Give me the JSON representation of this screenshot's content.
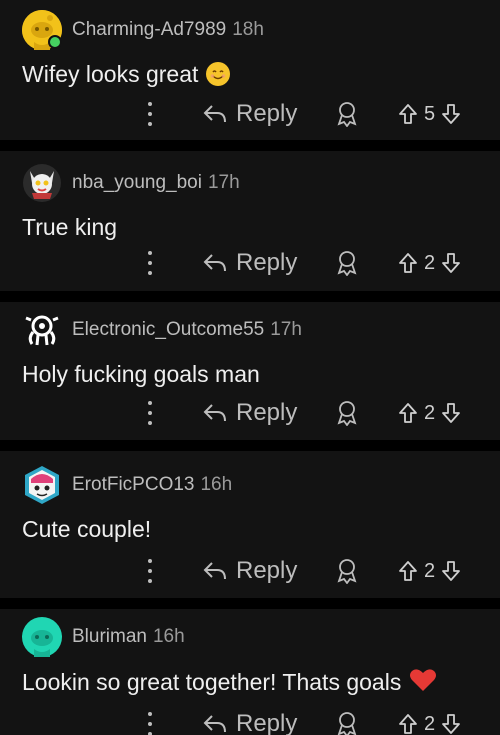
{
  "colors": {
    "background": "#000000",
    "card": "#131313",
    "online": "#46d160"
  },
  "comments": [
    {
      "username": "Charming-Ad7989",
      "time": "18h",
      "text": "Wifey looks great",
      "emoji": "smiling-face",
      "reply_label": "Reply",
      "votes": "5",
      "avatar": "reddit-snoo-yellow"
    },
    {
      "username": "nba_young_boi",
      "time": "17h",
      "text": "True king",
      "reply_label": "Reply",
      "votes": "2",
      "avatar": "fox-character"
    },
    {
      "username": "Electronic_Outcome55",
      "time": "17h",
      "text": "Holy fucking goals man",
      "reply_label": "Reply",
      "votes": "2",
      "avatar": "octopus-logo"
    },
    {
      "username": "ErotFicPCO13",
      "time": "16h",
      "text": "Cute couple!",
      "reply_label": "Reply",
      "votes": "2",
      "avatar": "hexagon-character"
    },
    {
      "username": "Bluriman",
      "time": "16h",
      "text": "Lookin so great together! Thats goals",
      "emoji": "red-heart",
      "reply_label": "Reply",
      "votes": "2",
      "avatar": "reddit-snoo-teal"
    }
  ]
}
